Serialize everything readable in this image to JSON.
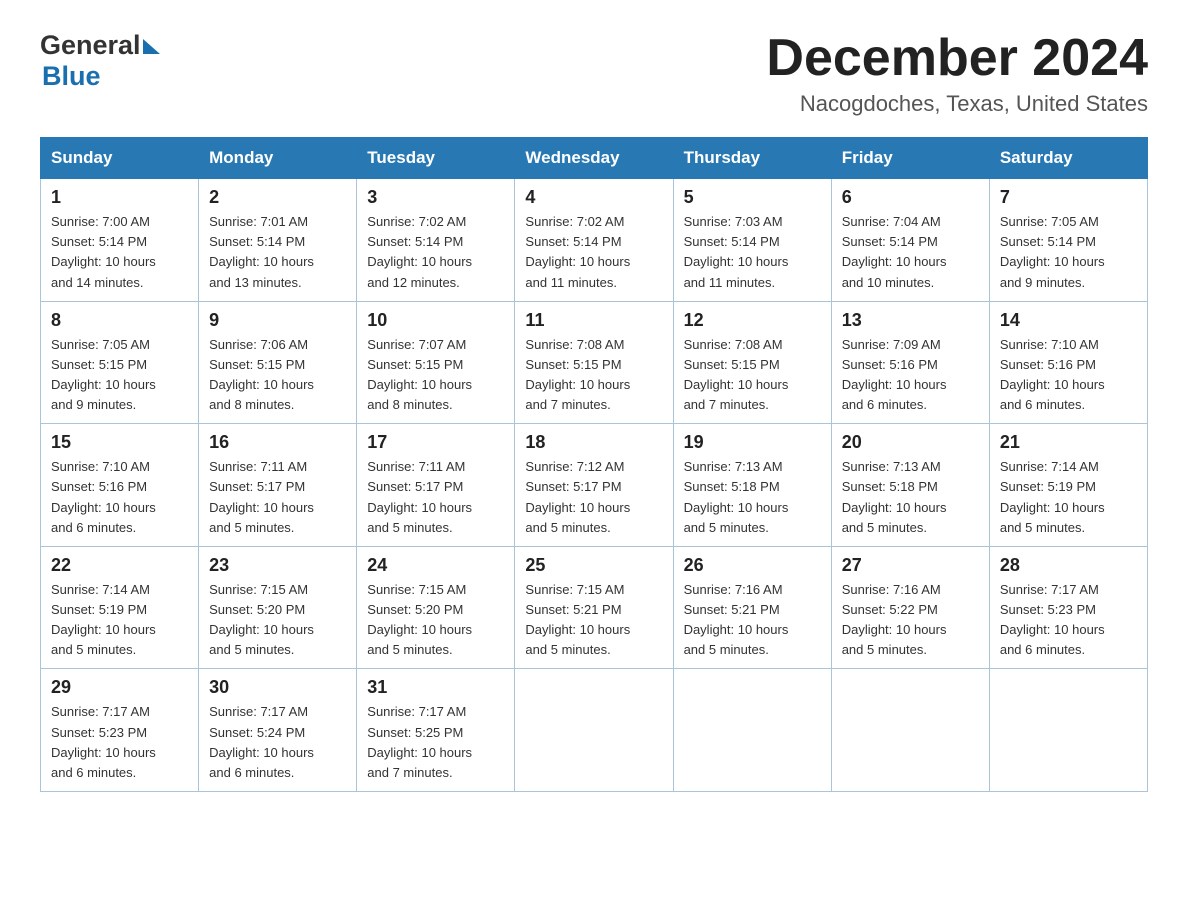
{
  "header": {
    "month_title": "December 2024",
    "location": "Nacogdoches, Texas, United States",
    "logo_general": "General",
    "logo_blue": "Blue"
  },
  "days_of_week": [
    "Sunday",
    "Monday",
    "Tuesday",
    "Wednesday",
    "Thursday",
    "Friday",
    "Saturday"
  ],
  "weeks": [
    [
      {
        "day": "1",
        "sunrise": "7:00 AM",
        "sunset": "5:14 PM",
        "daylight": "10 hours and 14 minutes."
      },
      {
        "day": "2",
        "sunrise": "7:01 AM",
        "sunset": "5:14 PM",
        "daylight": "10 hours and 13 minutes."
      },
      {
        "day": "3",
        "sunrise": "7:02 AM",
        "sunset": "5:14 PM",
        "daylight": "10 hours and 12 minutes."
      },
      {
        "day": "4",
        "sunrise": "7:02 AM",
        "sunset": "5:14 PM",
        "daylight": "10 hours and 11 minutes."
      },
      {
        "day": "5",
        "sunrise": "7:03 AM",
        "sunset": "5:14 PM",
        "daylight": "10 hours and 11 minutes."
      },
      {
        "day": "6",
        "sunrise": "7:04 AM",
        "sunset": "5:14 PM",
        "daylight": "10 hours and 10 minutes."
      },
      {
        "day": "7",
        "sunrise": "7:05 AM",
        "sunset": "5:14 PM",
        "daylight": "10 hours and 9 minutes."
      }
    ],
    [
      {
        "day": "8",
        "sunrise": "7:05 AM",
        "sunset": "5:15 PM",
        "daylight": "10 hours and 9 minutes."
      },
      {
        "day": "9",
        "sunrise": "7:06 AM",
        "sunset": "5:15 PM",
        "daylight": "10 hours and 8 minutes."
      },
      {
        "day": "10",
        "sunrise": "7:07 AM",
        "sunset": "5:15 PM",
        "daylight": "10 hours and 8 minutes."
      },
      {
        "day": "11",
        "sunrise": "7:08 AM",
        "sunset": "5:15 PM",
        "daylight": "10 hours and 7 minutes."
      },
      {
        "day": "12",
        "sunrise": "7:08 AM",
        "sunset": "5:15 PM",
        "daylight": "10 hours and 7 minutes."
      },
      {
        "day": "13",
        "sunrise": "7:09 AM",
        "sunset": "5:16 PM",
        "daylight": "10 hours and 6 minutes."
      },
      {
        "day": "14",
        "sunrise": "7:10 AM",
        "sunset": "5:16 PM",
        "daylight": "10 hours and 6 minutes."
      }
    ],
    [
      {
        "day": "15",
        "sunrise": "7:10 AM",
        "sunset": "5:16 PM",
        "daylight": "10 hours and 6 minutes."
      },
      {
        "day": "16",
        "sunrise": "7:11 AM",
        "sunset": "5:17 PM",
        "daylight": "10 hours and 5 minutes."
      },
      {
        "day": "17",
        "sunrise": "7:11 AM",
        "sunset": "5:17 PM",
        "daylight": "10 hours and 5 minutes."
      },
      {
        "day": "18",
        "sunrise": "7:12 AM",
        "sunset": "5:17 PM",
        "daylight": "10 hours and 5 minutes."
      },
      {
        "day": "19",
        "sunrise": "7:13 AM",
        "sunset": "5:18 PM",
        "daylight": "10 hours and 5 minutes."
      },
      {
        "day": "20",
        "sunrise": "7:13 AM",
        "sunset": "5:18 PM",
        "daylight": "10 hours and 5 minutes."
      },
      {
        "day": "21",
        "sunrise": "7:14 AM",
        "sunset": "5:19 PM",
        "daylight": "10 hours and 5 minutes."
      }
    ],
    [
      {
        "day": "22",
        "sunrise": "7:14 AM",
        "sunset": "5:19 PM",
        "daylight": "10 hours and 5 minutes."
      },
      {
        "day": "23",
        "sunrise": "7:15 AM",
        "sunset": "5:20 PM",
        "daylight": "10 hours and 5 minutes."
      },
      {
        "day": "24",
        "sunrise": "7:15 AM",
        "sunset": "5:20 PM",
        "daylight": "10 hours and 5 minutes."
      },
      {
        "day": "25",
        "sunrise": "7:15 AM",
        "sunset": "5:21 PM",
        "daylight": "10 hours and 5 minutes."
      },
      {
        "day": "26",
        "sunrise": "7:16 AM",
        "sunset": "5:21 PM",
        "daylight": "10 hours and 5 minutes."
      },
      {
        "day": "27",
        "sunrise": "7:16 AM",
        "sunset": "5:22 PM",
        "daylight": "10 hours and 5 minutes."
      },
      {
        "day": "28",
        "sunrise": "7:17 AM",
        "sunset": "5:23 PM",
        "daylight": "10 hours and 6 minutes."
      }
    ],
    [
      {
        "day": "29",
        "sunrise": "7:17 AM",
        "sunset": "5:23 PM",
        "daylight": "10 hours and 6 minutes."
      },
      {
        "day": "30",
        "sunrise": "7:17 AM",
        "sunset": "5:24 PM",
        "daylight": "10 hours and 6 minutes."
      },
      {
        "day": "31",
        "sunrise": "7:17 AM",
        "sunset": "5:25 PM",
        "daylight": "10 hours and 7 minutes."
      },
      null,
      null,
      null,
      null
    ]
  ],
  "labels": {
    "sunrise": "Sunrise:",
    "sunset": "Sunset:",
    "daylight": "Daylight:"
  }
}
